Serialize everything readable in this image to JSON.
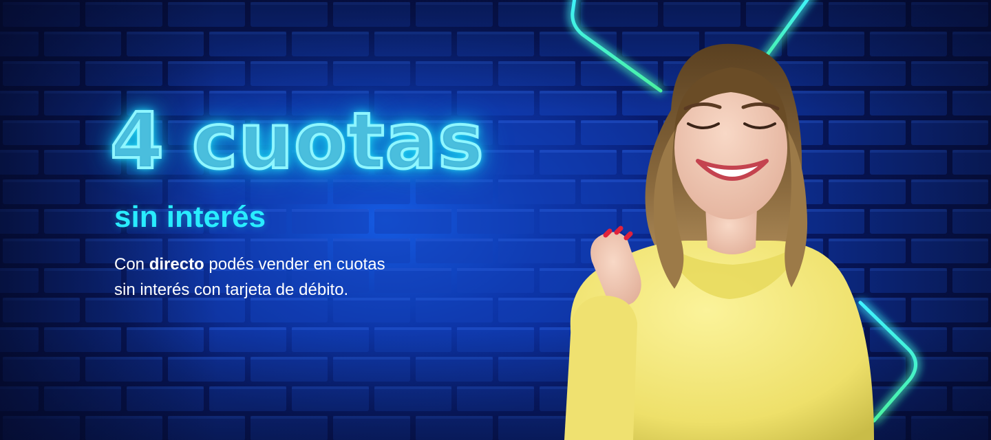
{
  "banner": {
    "headline": "4 cuotas",
    "subheadline": "sin interés",
    "description": {
      "line1_prefix": "Con ",
      "line1_brand": "directo",
      "line1_suffix": " podés vender en cuotas",
      "line2": "sin interés con tarjeta de débito."
    },
    "illustration": {
      "subject": "smiling-woman-yellow-hoodie",
      "background": "blue-brick-wall",
      "accent": "neon-cyan-lines"
    }
  },
  "colors": {
    "background": "#0b2a9a",
    "neon": "#29ecff",
    "text": "#ffffff",
    "hoodie": "#f6ec7a"
  }
}
